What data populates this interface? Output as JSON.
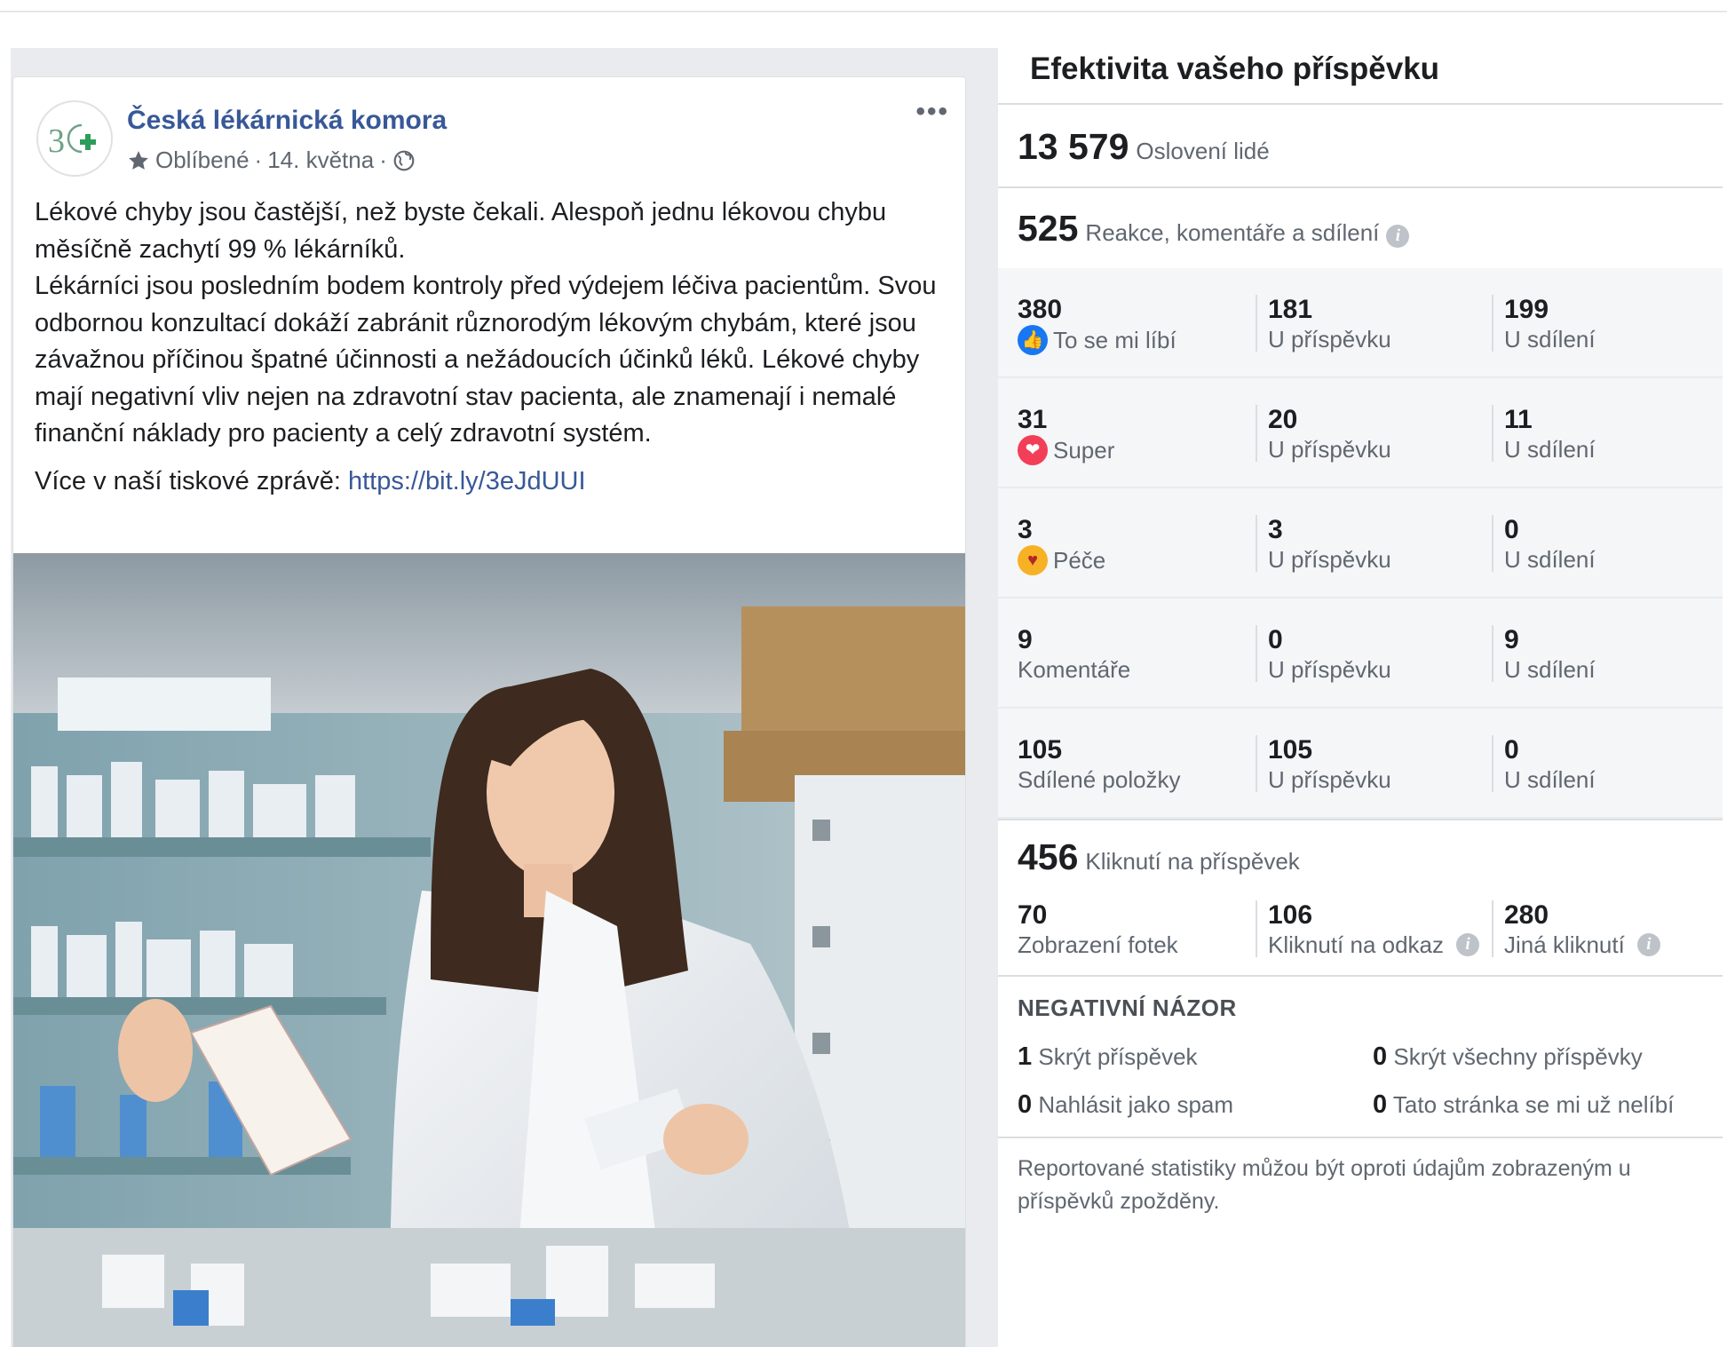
{
  "post": {
    "page_name": "Česká lékárnická komora",
    "meta_favorites": "Oblíbené",
    "meta_date": "14. května",
    "more_options": "•••",
    "paragraph1": "Lékové chyby jsou častější, než byste čekali. Alespoň jednu lékovou chybu měsíčně zachytí 99 % lékárníků.",
    "paragraph2": "Lékárníci jsou posledním bodem kontroly před výdejem léčiva pacientům. Svou odbornou konzultací dokáží zabránit různorodým lékovým chybám, které jsou závažnou příčinou špatné účinnosti a nežádoucích účinků léků. Lékové chyby mají negativní vliv nejen na zdravotní stav pacienta, ale znamenají i nemalé finanční náklady pro pacienty a celý zdravotní systém.",
    "more_prefix": "Více v naší tiskové zprávě: ",
    "link": "https://bit.ly/3eJdUUI"
  },
  "insights": {
    "title": "Efektivita vašeho příspěvku",
    "reach": {
      "value": "13 579",
      "label": "Oslovení lidé"
    },
    "engagement": {
      "value": "525",
      "label": "Reakce, komentáře a sdílení"
    },
    "rows": [
      {
        "total": "380",
        "label": "To se mi líbí",
        "icon": "like-icon",
        "on_post": "181",
        "on_post_label": "U příspěvku",
        "on_shares": "199",
        "on_shares_label": "U sdílení"
      },
      {
        "total": "31",
        "label": "Super",
        "icon": "love-icon",
        "on_post": "20",
        "on_post_label": "U příspěvku",
        "on_shares": "11",
        "on_shares_label": "U sdílení"
      },
      {
        "total": "3",
        "label": "Péče",
        "icon": "care-icon",
        "on_post": "3",
        "on_post_label": "U příspěvku",
        "on_shares": "0",
        "on_shares_label": "U sdílení"
      },
      {
        "total": "9",
        "label": "Komentáře",
        "icon": "",
        "on_post": "0",
        "on_post_label": "U příspěvku",
        "on_shares": "9",
        "on_shares_label": "U sdílení"
      },
      {
        "total": "105",
        "label": "Sdílené položky",
        "icon": "",
        "on_post": "105",
        "on_post_label": "U příspěvku",
        "on_shares": "0",
        "on_shares_label": "U sdílení"
      }
    ],
    "clicks": {
      "value": "456",
      "label": "Kliknutí na příspěvek"
    },
    "click_breakdown": [
      {
        "value": "70",
        "label": "Zobrazení fotek"
      },
      {
        "value": "106",
        "label": "Kliknutí na odkaz"
      },
      {
        "value": "280",
        "label": "Jiná kliknutí"
      }
    ],
    "negative": {
      "title": "NEGATIVNÍ NÁZOR",
      "items": [
        {
          "value": "1",
          "label": "Skrýt příspěvek"
        },
        {
          "value": "0",
          "label": "Skrýt všechny příspěvky"
        },
        {
          "value": "0",
          "label": "Nahlásit jako spam"
        },
        {
          "value": "0",
          "label": "Tato stránka se mi už nelíbí"
        }
      ]
    },
    "footer_note": "Reportované statistiky můžou být oproti údajům zobrazeným u příspěvků zpožděny.",
    "info_glyph": "i"
  },
  "colors": {
    "brand_link": "#385898",
    "like": "#1877f2",
    "love": "#f33e58",
    "care": "#f7b125"
  }
}
